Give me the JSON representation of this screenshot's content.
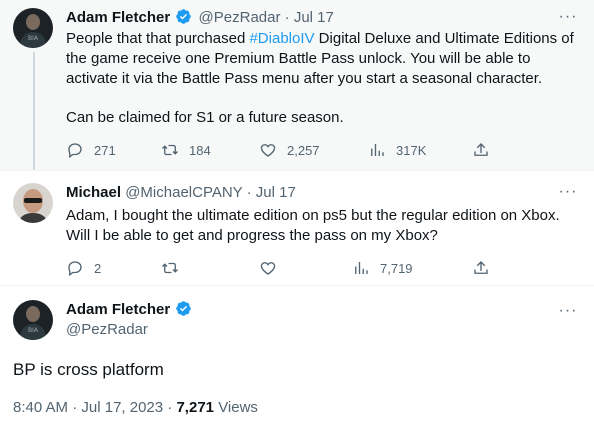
{
  "colors": {
    "link": "#1d9bf0",
    "muted": "#536471",
    "text": "#0f1419",
    "verified": "#1d9bf0"
  },
  "tweet1": {
    "name": "Adam Fletcher",
    "handle": "@PezRadar",
    "separator": "·",
    "time": "Jul 17",
    "text_before": "People that that purchased ",
    "hashtag": "#DiabloIV",
    "text_after": " Digital Deluxe and Ultimate Editions of the game receive one Premium Battle Pass unlock. You will be able to activate it via the Battle Pass menu after you start a seasonal character.",
    "text_second": "Can be claimed for S1 or a future season.",
    "replies": "271",
    "retweets": "184",
    "likes": "2,257",
    "views": "317K"
  },
  "tweet2": {
    "name": "Michael",
    "handle": "@MichaelCPANY",
    "separator": "·",
    "time": "Jul 17",
    "text": "Adam, I bought the ultimate edition on ps5 but the regular edition on Xbox. Will I be able to get and progress the pass on my Xbox?",
    "replies": "2",
    "views": "7,719"
  },
  "main": {
    "name": "Adam Fletcher",
    "handle": "@PezRadar",
    "text": "BP is cross platform",
    "time": "8:40 AM",
    "separator": "·",
    "date": "Jul 17, 2023",
    "views_count": "7,271",
    "views_label": "Views"
  },
  "icons": [
    "more-icon",
    "verified-icon",
    "reply-icon",
    "retweet-icon",
    "like-icon",
    "views-icon",
    "share-icon"
  ]
}
